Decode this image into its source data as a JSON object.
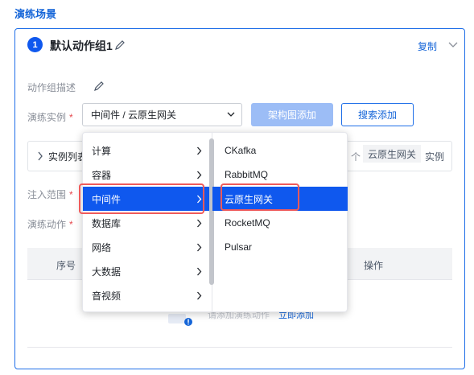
{
  "section_title": "演练场景",
  "group": {
    "index": "1",
    "title": "默认动作组1",
    "copy_label": "复制"
  },
  "form": {
    "desc_label": "动作组描述",
    "instance_label": "演练实例",
    "instance_value": "中间件 / 云原生网关",
    "arch_add_label": "架构图添加",
    "search_add_label": "搜索添加",
    "instance_list_label": "实例列表",
    "instance_count_tail": "个",
    "instance_tag": "云原生网关",
    "instance_unit": "实例",
    "inject_label": "注入范围",
    "action_label": "演练动作"
  },
  "table": {
    "col_seq": "序号",
    "col_op": "操作",
    "empty_text": "请添加演练动作",
    "empty_link": "立即添加"
  },
  "dropdown": {
    "categories": [
      {
        "label": "计算"
      },
      {
        "label": "容器"
      },
      {
        "label": "中间件"
      },
      {
        "label": "数据库"
      },
      {
        "label": "网络"
      },
      {
        "label": "大数据"
      },
      {
        "label": "音视频"
      }
    ],
    "active_category": "中间件",
    "subitems": [
      {
        "label": "CKafka"
      },
      {
        "label": "RabbitMQ"
      },
      {
        "label": "云原生网关"
      },
      {
        "label": "RocketMQ"
      },
      {
        "label": "Pulsar"
      }
    ],
    "active_subitem": "云原生网关"
  },
  "colors": {
    "accent": "#0f58ee",
    "link": "#1565d8",
    "highlight": "#ef5a5a",
    "disabled_button": "#9cbdf6"
  }
}
